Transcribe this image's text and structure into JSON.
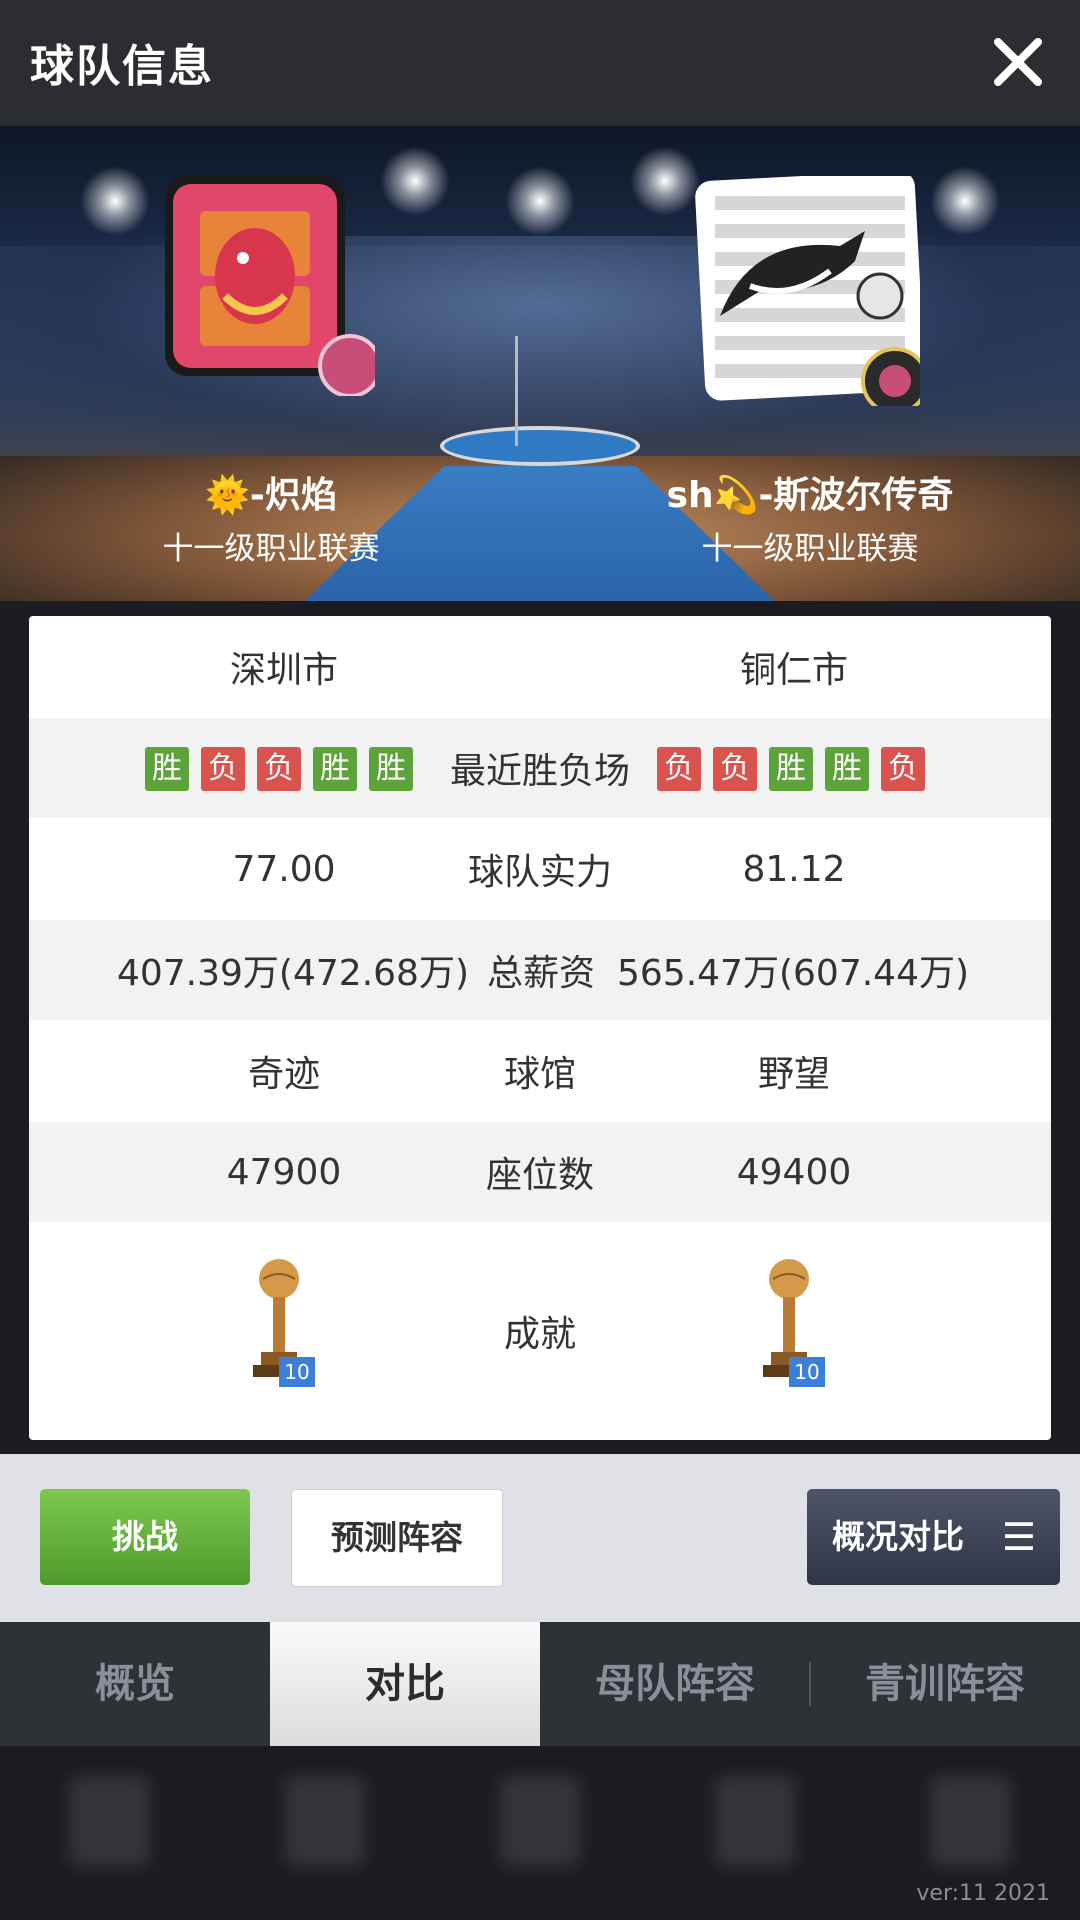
{
  "header": {
    "title": "球队信息",
    "close_icon": "close-icon"
  },
  "teams": {
    "left": {
      "name": "🌞-炽焰",
      "league": "十一级职业联赛",
      "city": "深圳市",
      "strength": "77.00",
      "salary": "407.39万(472.68万)",
      "arena": "奇迹",
      "seats": "47900",
      "trophy_count": "10",
      "recent": [
        "胜",
        "负",
        "负",
        "胜",
        "胜"
      ]
    },
    "right": {
      "name": "sh💫-斯波尔传奇",
      "league": "十一级职业联赛",
      "city": "铜仁市",
      "strength": "81.12",
      "salary": "565.47万(607.44万)",
      "arena": "野望",
      "seats": "49400",
      "trophy_count": "10",
      "recent": [
        "负",
        "负",
        "胜",
        "胜",
        "负"
      ]
    }
  },
  "labels": {
    "recent": "最近胜负场",
    "strength": "球队实力",
    "salary": "总薪资",
    "arena": "球馆",
    "seats": "座位数",
    "achievements": "成就"
  },
  "actions": {
    "challenge": "挑战",
    "predict": "预测阵容",
    "compare": "概况对比",
    "compare_menu": "☰"
  },
  "tabs": [
    {
      "label": "概览"
    },
    {
      "label": "对比",
      "active": true
    },
    {
      "label": "母队阵容"
    },
    {
      "label": "青训阵容"
    }
  ],
  "footer": {
    "version": "ver:11  2021"
  },
  "colors": {
    "win": "#5ca33a",
    "lose": "#d9544f",
    "challenge": "#6bb640"
  }
}
